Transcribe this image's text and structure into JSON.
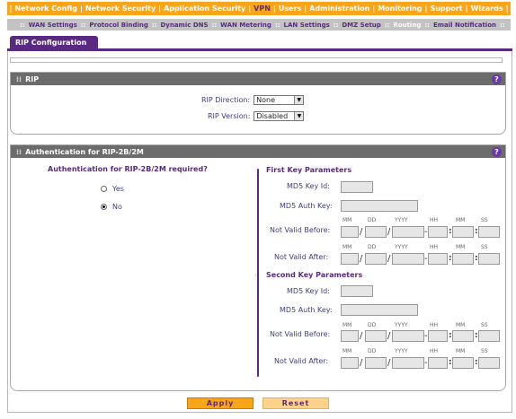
{
  "topnav": {
    "items": [
      "Network Config",
      "Network Security",
      "Application Security",
      "VPN",
      "Users",
      "Administration",
      "Monitoring",
      "Support",
      "Wizards"
    ]
  },
  "subnav": {
    "items": [
      "WAN Settings",
      "Protocol Binding",
      "Dynamic DNS",
      "WAN Metering",
      "LAN Settings",
      "DMZ Setup",
      "Routing",
      "Email Notification"
    ]
  },
  "tab": {
    "label": "RIP Configuration"
  },
  "rip": {
    "header": "RIP",
    "direction_label": "RIP Direction:",
    "direction_value": "None",
    "version_label": "RIP Version:",
    "version_value": "Disabled"
  },
  "auth": {
    "header": "Authentication for RIP-2B/2M",
    "required_title": "Authentication for RIP-2B/2M required?",
    "yes_label": "Yes",
    "no_label": "No",
    "selected": "No",
    "first_title": "First Key Parameters",
    "second_title": "Second Key Parameters",
    "md5_key_id_label": "MD5 Key Id:",
    "md5_auth_key_label": "MD5 Auth Key:",
    "not_valid_before_label": "Not Valid Before:",
    "not_valid_after_label": "Not Valid After:",
    "col_mm": "MM",
    "col_dd": "DD",
    "col_yyyy": "YYYY",
    "col_hh": "HH",
    "col_min": "MM",
    "col_ss": "SS"
  },
  "buttons": {
    "apply": "Apply",
    "reset": "Reset"
  },
  "colors": {
    "accent": "#f9a51a",
    "brand": "#5a2a82",
    "header_gray": "#6c6c6c"
  }
}
